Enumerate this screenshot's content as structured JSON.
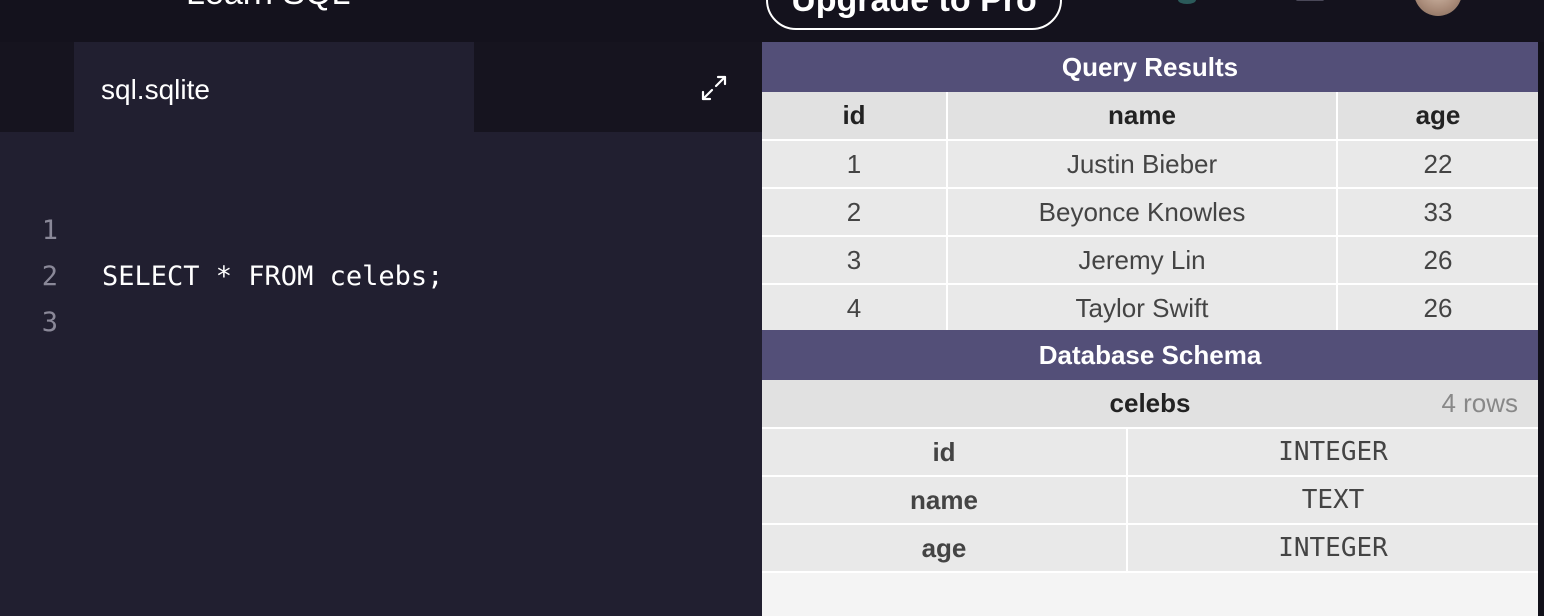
{
  "topbar": {
    "course_title": "Learn SQL",
    "upgrade_label": "Upgrade to Pro"
  },
  "editor": {
    "file_tab": "sql.sqlite",
    "lines": [
      {
        "num": "1",
        "code": "SELECT * FROM celebs;"
      },
      {
        "num": "2",
        "code": ""
      },
      {
        "num": "3",
        "code": ""
      }
    ]
  },
  "query_results": {
    "title": "Query Results",
    "columns": [
      "id",
      "name",
      "age"
    ],
    "rows": [
      [
        "1",
        "Justin Bieber",
        "22"
      ],
      [
        "2",
        "Beyonce Knowles",
        "33"
      ],
      [
        "3",
        "Jeremy Lin",
        "26"
      ],
      [
        "4",
        "Taylor Swift",
        "26"
      ]
    ]
  },
  "schema": {
    "title": "Database Schema",
    "table_name": "celebs",
    "row_count": "4 rows",
    "fields": [
      {
        "name": "id",
        "type": "INTEGER"
      },
      {
        "name": "name",
        "type": "TEXT"
      },
      {
        "name": "age",
        "type": "INTEGER"
      }
    ]
  },
  "colors": {
    "editor_bg": "#211f30",
    "header_bg": "#534f78",
    "cell_bg": "#e9e9e9"
  },
  "icons": {
    "expand": "expand-icon",
    "notifications": "bell-icon"
  }
}
